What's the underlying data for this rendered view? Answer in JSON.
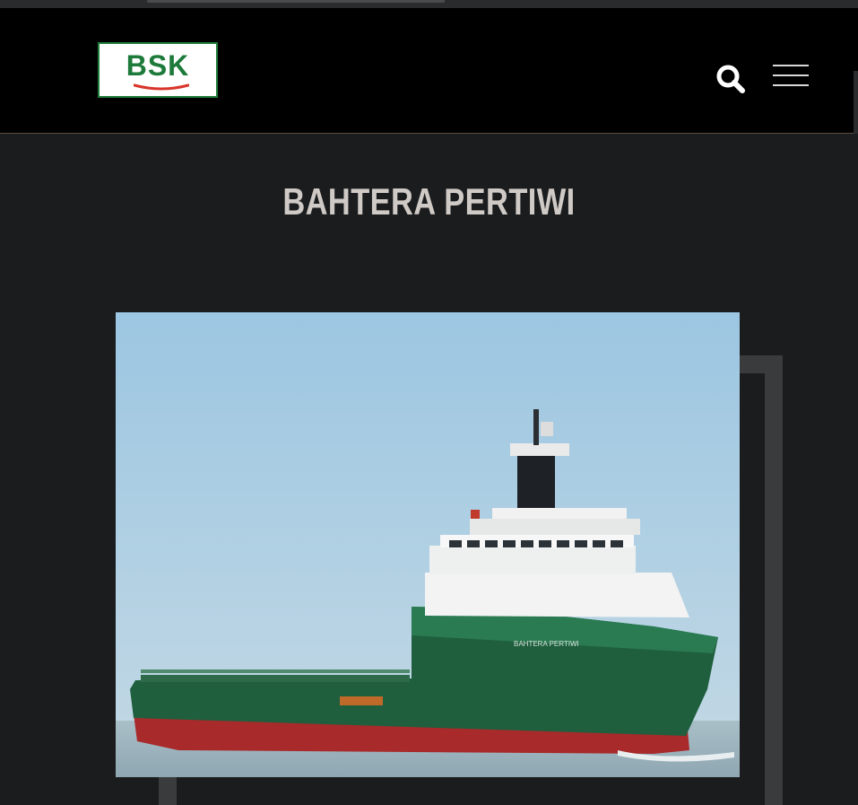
{
  "header": {
    "logo_text": "BSK",
    "logo_alt": "BSK logo",
    "search_label": "Search",
    "menu_label": "Menu"
  },
  "page": {
    "title": "BAHTERA PERTIWI"
  },
  "image": {
    "alt": "Offshore supply vessel Bahtera Pertiwi at sea"
  },
  "colors": {
    "background": "#1b1c1e",
    "header": "#000000",
    "logo_green": "#1d7a3a",
    "logo_red": "#d9352b",
    "title": "#cfcac6",
    "frame": "#3a3b3d"
  }
}
